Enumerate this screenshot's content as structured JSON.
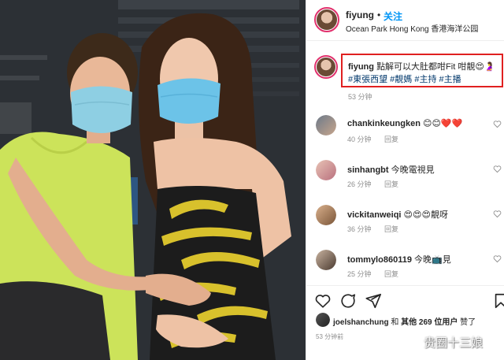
{
  "post": {
    "username": "fiyung",
    "separator": "•",
    "follow_label": "关注",
    "location": "Ocean Park Hong Kong 香港海洋公园"
  },
  "caption": {
    "username": "fiyung",
    "text": "點解可以大肚都咁Fit 咁靚",
    "emojis": "😍🤰",
    "hashtags": "#東張西望 #靚媽 #主持 #主播",
    "time": "53 分钟"
  },
  "comments": [
    {
      "username": "chankinkeungken",
      "text": "😊😊❤️❤️",
      "time": "40 分钟",
      "reply": "回复"
    },
    {
      "username": "sinhangbt",
      "text": "今晚電視見",
      "time": "26 分钟",
      "reply": "回复"
    },
    {
      "username": "vickitanweiqi",
      "text": "😍😍😍靚呀",
      "time": "36 分钟",
      "reply": "回复"
    },
    {
      "username": "tommylo860119",
      "text": "今晚📺見",
      "time": "25 分钟",
      "reply": "回复"
    }
  ],
  "likes": {
    "username": "joelshanchung",
    "middle": "和",
    "others": "其他 269 位用户",
    "suffix": "赞了"
  },
  "post_time": "53 分钟前",
  "watermark": "贵圈十三娘",
  "icons": [
    "heart-icon",
    "comment-icon",
    "share-icon",
    "bookmark-icon"
  ],
  "colors": {
    "accent": "#0095f6",
    "highlight_box": "#e02020",
    "hashtag": "#00376b",
    "meta": "#8e8e8e"
  }
}
